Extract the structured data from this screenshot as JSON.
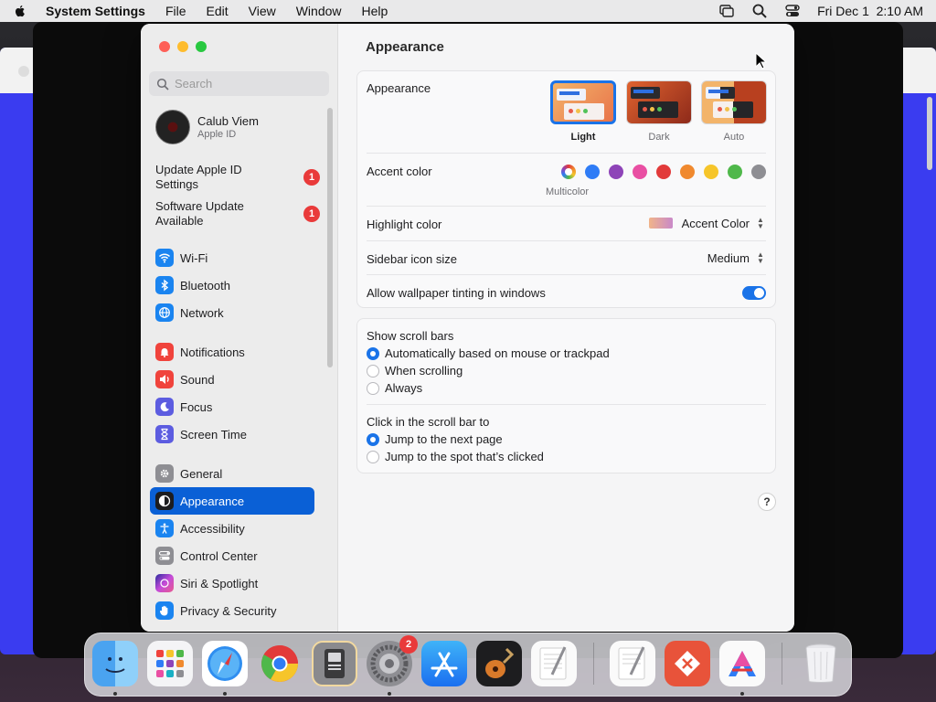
{
  "menubar": {
    "app_name": "System Settings",
    "menus": [
      "File",
      "Edit",
      "View",
      "Window",
      "Help"
    ],
    "clock": "Fri Dec 1  2:10 AM"
  },
  "sidebar": {
    "search_placeholder": "Search",
    "profile": {
      "name": "Calub Viem",
      "subtitle": "Apple ID"
    },
    "notices": [
      {
        "label": "Update Apple ID Settings",
        "badge": "1"
      },
      {
        "label": "Software Update Available",
        "badge": "1"
      }
    ],
    "items": [
      {
        "label": "Wi-Fi",
        "icon": "wifi-icon",
        "color": "#1a84f0"
      },
      {
        "label": "Bluetooth",
        "icon": "bluetooth-icon",
        "color": "#1a84f0"
      },
      {
        "label": "Network",
        "icon": "globe-icon",
        "color": "#1a84f0"
      },
      {
        "label": "Notifications",
        "icon": "bell-icon",
        "color": "#f0433c"
      },
      {
        "label": "Sound",
        "icon": "speaker-icon",
        "color": "#f0433c"
      },
      {
        "label": "Focus",
        "icon": "moon-icon",
        "color": "#5c5ce0"
      },
      {
        "label": "Screen Time",
        "icon": "hourglass-icon",
        "color": "#5c5ce0"
      },
      {
        "label": "General",
        "icon": "gear-icon",
        "color": "#8e8e93"
      },
      {
        "label": "Appearance",
        "icon": "appearance-icon",
        "color": "#1d1d1f"
      },
      {
        "label": "Accessibility",
        "icon": "accessibility-icon",
        "color": "#1a84f0"
      },
      {
        "label": "Control Center",
        "icon": "control-center-icon",
        "color": "#8e8e93"
      },
      {
        "label": "Siri & Spotlight",
        "icon": "siri-icon",
        "color": "#c44bd9"
      },
      {
        "label": "Privacy & Security",
        "icon": "hand-icon",
        "color": "#1a84f0"
      }
    ],
    "active_item": "Appearance"
  },
  "main": {
    "title": "Appearance",
    "appearance": {
      "label": "Appearance",
      "options": [
        "Light",
        "Dark",
        "Auto"
      ],
      "selected": "Light"
    },
    "accent": {
      "label": "Accent color",
      "selected_caption": "Multicolor",
      "colors": [
        "#2f7cf6",
        "#8e44b8",
        "#e94fa3",
        "#e23a3a",
        "#f0892e",
        "#f6c52a",
        "#4fb84a",
        "#8e8e93"
      ]
    },
    "highlight": {
      "label": "Highlight color",
      "value": "Accent Color"
    },
    "sidebar_icon_size": {
      "label": "Sidebar icon size",
      "value": "Medium"
    },
    "wallpaper_tinting": {
      "label": "Allow wallpaper tinting in windows",
      "enabled": true
    },
    "scroll_bars": {
      "label": "Show scroll bars",
      "options": [
        "Automatically based on mouse or trackpad",
        "When scrolling",
        "Always"
      ],
      "selected": "Automatically based on mouse or trackpad"
    },
    "click_scroll": {
      "label": "Click in the scroll bar to",
      "options": [
        "Jump to the next page",
        "Jump to the spot that’s clicked"
      ],
      "selected": "Jump to the next page"
    },
    "help_label": "?"
  },
  "dock": {
    "items": [
      {
        "name": "finder",
        "running": true
      },
      {
        "name": "launchpad",
        "running": false
      },
      {
        "name": "safari",
        "running": true
      },
      {
        "name": "chrome",
        "running": false
      },
      {
        "name": "system-information",
        "running": false
      },
      {
        "name": "system-settings",
        "running": true,
        "badge": "2"
      },
      {
        "name": "app-store",
        "running": false
      },
      {
        "name": "garageband",
        "running": false
      },
      {
        "name": "textedit",
        "running": false
      },
      {
        "name": "textedit-document",
        "running": false
      },
      {
        "name": "remote-desktop",
        "running": false
      },
      {
        "name": "affinity",
        "running": true
      },
      {
        "name": "trash",
        "running": false
      }
    ]
  }
}
